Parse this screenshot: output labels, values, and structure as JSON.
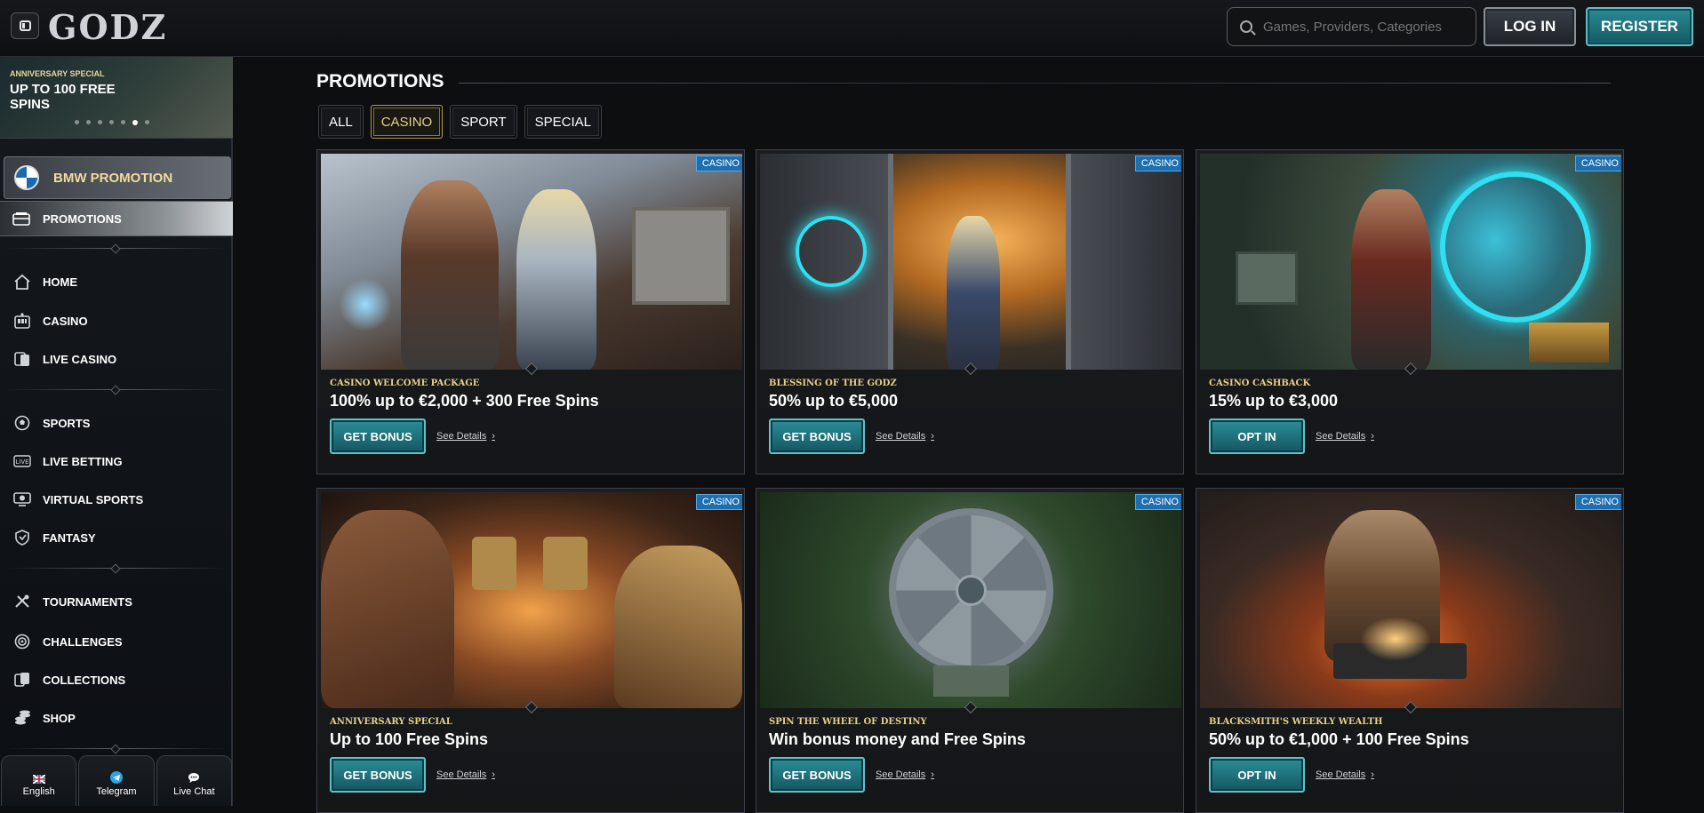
{
  "header": {
    "logo": "GODZ",
    "search_placeholder": "Games, Providers, Categories",
    "login_label": "LOG IN",
    "register_label": "REGISTER"
  },
  "sidebar": {
    "banner": {
      "tag": "Anniversary Special",
      "title": "UP TO 100 FREE SPINS",
      "dots": 7,
      "active_dot": 5
    },
    "bmw_label": "BMW PROMOTION",
    "active_item": "PROMOTIONS",
    "groups": [
      [
        {
          "label": "HOME",
          "icon": "home-icon"
        },
        {
          "label": "CASINO",
          "icon": "slot-machine-icon"
        },
        {
          "label": "LIVE CASINO",
          "icon": "live-casino-icon"
        }
      ],
      [
        {
          "label": "SPORTS",
          "icon": "soccer-ball-icon"
        },
        {
          "label": "LIVE BETTING",
          "icon": "live-badge-icon"
        },
        {
          "label": "VIRTUAL SPORTS",
          "icon": "virtual-sports-icon"
        },
        {
          "label": "FANTASY",
          "icon": "shield-icon"
        }
      ],
      [
        {
          "label": "TOURNAMENTS",
          "icon": "tournament-icon"
        },
        {
          "label": "CHALLENGES",
          "icon": "target-icon"
        },
        {
          "label": "COLLECTIONS",
          "icon": "cards-icon"
        },
        {
          "label": "SHOP",
          "icon": "coins-icon"
        }
      ]
    ],
    "footer": [
      {
        "label": "English",
        "icon": "uk-flag-icon"
      },
      {
        "label": "Telegram",
        "icon": "telegram-icon"
      },
      {
        "label": "Live Chat",
        "icon": "chat-icon"
      }
    ]
  },
  "main": {
    "title": "PROMOTIONS",
    "filters": [
      {
        "label": "ALL",
        "active": false
      },
      {
        "label": "CASINO",
        "active": true
      },
      {
        "label": "SPORT",
        "active": false
      },
      {
        "label": "SPECIAL",
        "active": false
      }
    ],
    "cards": [
      {
        "badge": "CASINO",
        "tag": "Casino Welcome Package",
        "title": "100% up to €2,000 + 300 Free Spins",
        "button": "GET BONUS",
        "details": "See Details"
      },
      {
        "badge": "CASINO",
        "tag": "Blessing of the Godz",
        "title": "50% up to €5,000",
        "button": "GET BONUS",
        "details": "See Details"
      },
      {
        "badge": "CASINO",
        "tag": "Casino Cashback",
        "title": "15% up to €3,000",
        "button": "OPT IN",
        "details": "See Details"
      },
      {
        "badge": "CASINO",
        "tag": "Anniversary Special",
        "title": "Up to 100 Free Spins",
        "button": "GET BONUS",
        "details": "See Details"
      },
      {
        "badge": "CASINO",
        "tag": "Spin the Wheel of Destiny",
        "title": "Win bonus money and Free Spins",
        "button": "GET BONUS",
        "details": "See Details"
      },
      {
        "badge": "CASINO",
        "tag": "Blacksmith's Weekly Wealth",
        "title": "50% up to €1,000 + 100 Free Spins",
        "button": "OPT IN",
        "details": "See Details"
      }
    ]
  },
  "colors": {
    "accent_teal": "#2a8a95",
    "accent_gold": "#e6d08a",
    "badge_blue": "#1e6fb0",
    "background": "#0d0e10"
  }
}
